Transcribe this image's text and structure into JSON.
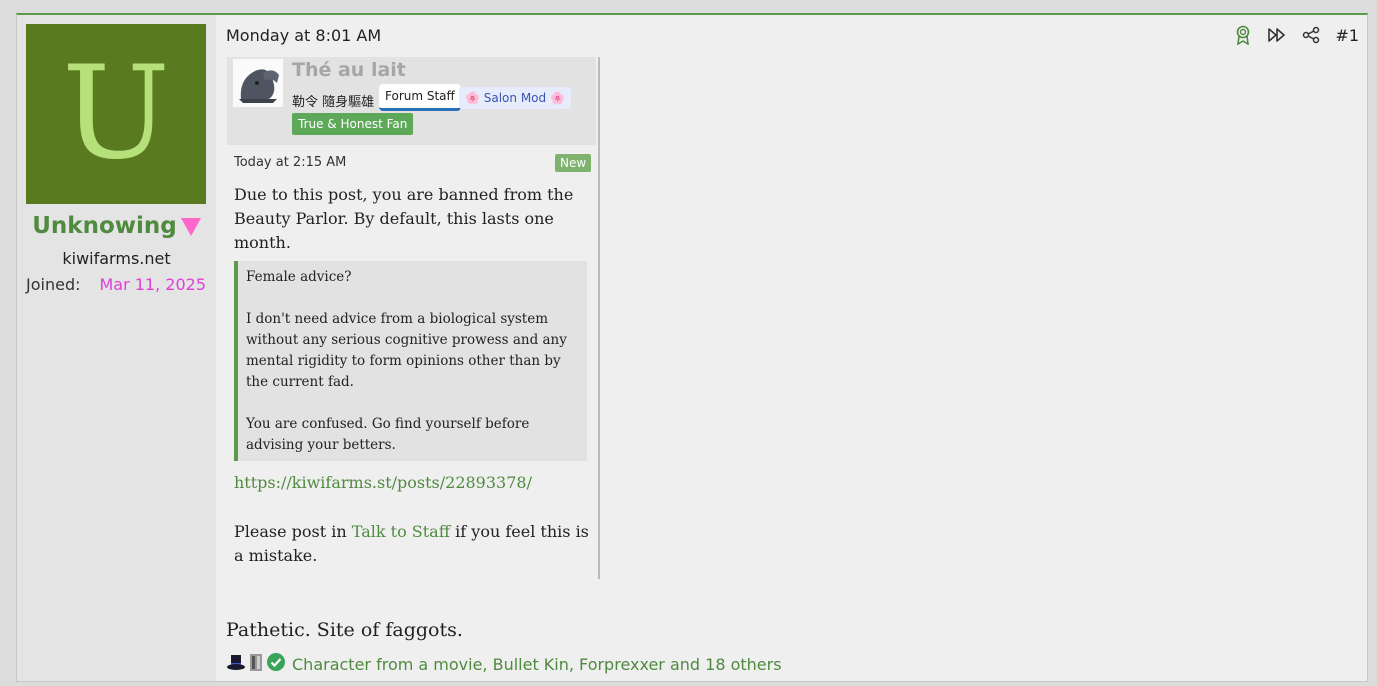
{
  "post": {
    "timestamp": "Monday at 8:01 AM",
    "number": "#1",
    "body": "Pathetic. Site of faggots."
  },
  "user": {
    "avatar_letter": "U",
    "avatar_bg": "#5a7a20",
    "avatar_fg": "#b5e07a",
    "name": "Unknowing",
    "site": "kiwifarms.net",
    "joined_label": "Joined:",
    "joined_value": "Mar 11, 2025"
  },
  "actions": {
    "icons": [
      "award-icon",
      "fast-forward-icon",
      "share-icon"
    ]
  },
  "quote": {
    "author": "Thé au lait",
    "title": "勒令 隨身驅雄",
    "badge_staff": "Forum Staff",
    "badge_salon": "🌸 Salon Mod 🌸",
    "badge_fan": "True & Honest Fan",
    "time": "Today at 2:15 AM",
    "new_label": "New",
    "text": "Due to this post, you are banned from the Beauty Parlor. By default, this lasts one month.",
    "inner": {
      "p1": "Female advice?",
      "p2": "I don't need advice from a biological system without any serious cognitive prowess and any mental rigidity to form opinions other than by the current fad.",
      "p3": "You are confused. Go find yourself before advising your betters."
    },
    "link": "https://kiwifarms.st/posts/22893378/",
    "footer_pre": "Please post in ",
    "footer_link": "Talk to Staff",
    "footer_post": " if you feel this is a mistake."
  },
  "reactions": {
    "icons": [
      "top-hat-icon",
      "character-icon",
      "checkmark-icon"
    ],
    "text": "Character from a movie, Bullet Kin, Forprexxer and 18 others"
  }
}
